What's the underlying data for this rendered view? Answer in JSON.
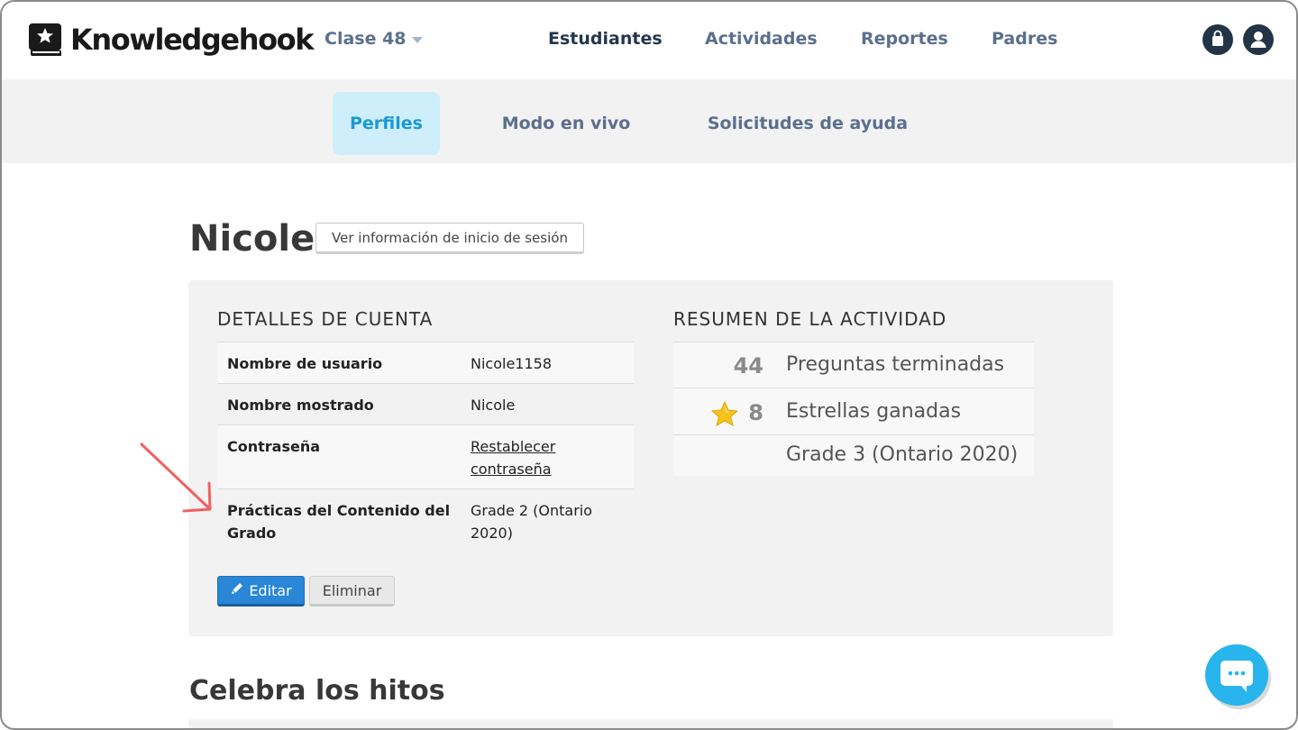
{
  "brand": {
    "name": "Knowledgehook"
  },
  "class_selector": {
    "label": "Clase 48"
  },
  "main_nav": {
    "estudiantes": "Estudiantes",
    "actividades": "Actividades",
    "reportes": "Reportes",
    "padres": "Padres",
    "active": "Estudiantes"
  },
  "sub_nav": {
    "perfiles": "Perfiles",
    "modo_vivo": "Modo en vivo",
    "solicitudes": "Solicitudes de ayuda",
    "active": "Perfiles"
  },
  "profile": {
    "name": "Nicole",
    "login_info_button": "Ver información de inicio de sesión"
  },
  "account_details": {
    "title": "DETALLES DE CUENTA",
    "rows": [
      {
        "label": "Nombre de usuario",
        "value": "Nicole1158"
      },
      {
        "label": "Nombre mostrado",
        "value": "Nicole"
      },
      {
        "label": "Contraseña",
        "value": "Restablecer contraseña"
      },
      {
        "label": "Prácticas del Contenido del Grado",
        "value": "Grade 2 (Ontario 2020)"
      }
    ],
    "edit_button": "Editar",
    "delete_button": "Eliminar"
  },
  "activity_summary": {
    "title": "RESUMEN DE LA ACTIVIDAD",
    "questions_count": "44",
    "questions_label": "Preguntas terminadas",
    "stars_count": "8",
    "stars_label": "Estrellas ganadas",
    "grade_label": "Grade 3 (Ontario 2020)"
  },
  "milestones": {
    "title": "Celebra los hitos"
  },
  "icons": {
    "logo": "book-star-icon",
    "shop": "shopping-bag-icon",
    "user": "user-icon",
    "edit": "pencil-icon",
    "star": "star-icon",
    "chat": "chat-icon",
    "annotation": "arrow-icon"
  },
  "colors": {
    "nav_text": "#5b6f8e",
    "nav_active": "#25364f",
    "subtab_active_bg": "#cdeefa",
    "subtab_active_text": "#1b9ad1",
    "primary_button": "#2a86d6",
    "link": "#1b8ed6",
    "arrow": "#f06060",
    "chat": "#28b4ec"
  }
}
